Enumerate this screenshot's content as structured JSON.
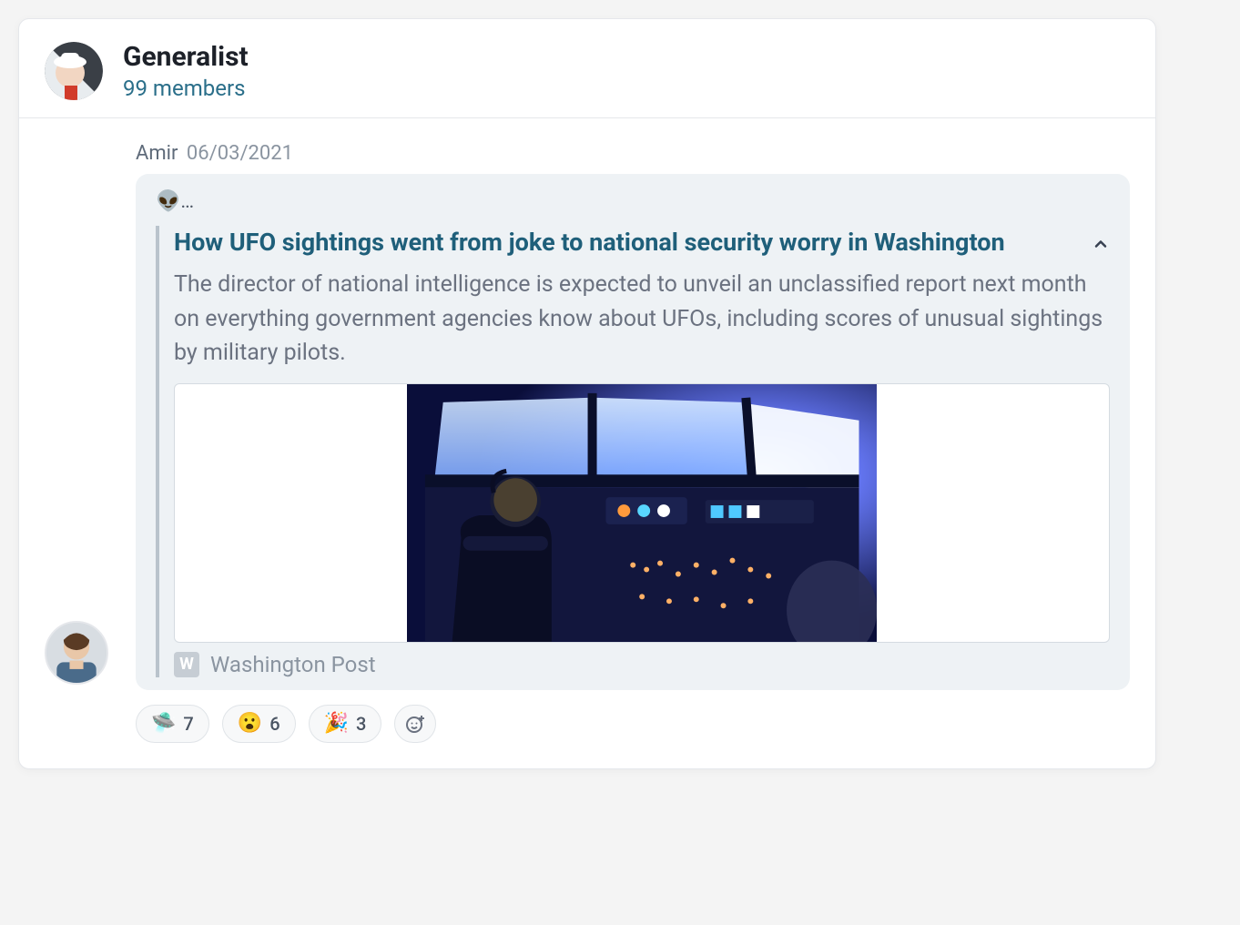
{
  "group": {
    "name": "Generalist",
    "members_text": "99 members"
  },
  "post": {
    "author": "Amir",
    "date": "06/03/2021",
    "lead": "👽…",
    "link": {
      "title": "How UFO sightings went from joke to national security worry in Washington",
      "description": "The director of national intelligence is expected to unveil an unclassified report next month on everything government agencies know about UFOs, including scores of unusual sightings by military pilots.",
      "source_badge": "W",
      "source_name": "Washington Post"
    }
  },
  "reactions": [
    {
      "emoji": "🛸",
      "count": "7"
    },
    {
      "emoji": "😮",
      "count": "6"
    },
    {
      "emoji": "🎉",
      "count": "3"
    }
  ]
}
